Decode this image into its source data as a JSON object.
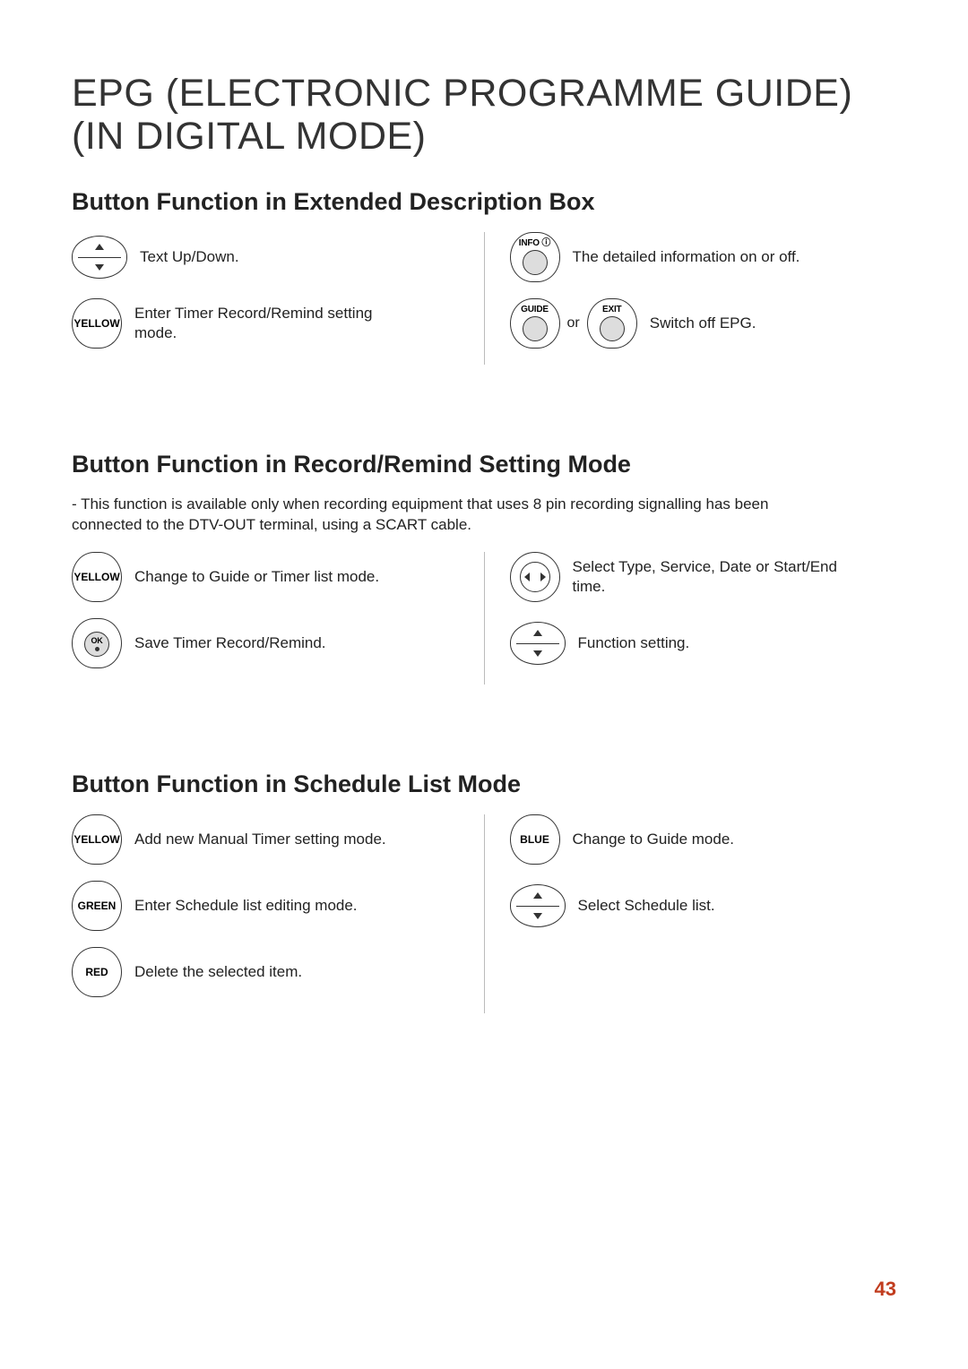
{
  "title_line1": "EPG (ELECTRONIC PROGRAMME GUIDE)",
  "title_line2": "(IN DIGITAL MODE)",
  "page_number": "43",
  "s1": {
    "heading": "Button Function in Extended Description Box",
    "rows_left": [
      {
        "icon": "updown",
        "label": "",
        "desc": "Text Up/Down."
      },
      {
        "icon": "label",
        "label": "YELLOW",
        "desc": "Enter Timer Record/Remind setting mode."
      }
    ],
    "rows_right": [
      {
        "icon": "round",
        "label": "INFO ⓘ",
        "desc": "The detailed information on or off."
      },
      {
        "icon": "guide_or_exit",
        "label1": "GUIDE",
        "or": "or",
        "label2": "EXIT",
        "desc": "Switch off EPG."
      }
    ]
  },
  "s2": {
    "heading": "Button Function in Record/Remind Setting Mode",
    "note": "-  This function is available only when recording equipment that uses 8 pin recording signalling has been connected to the DTV-OUT terminal, using a SCART cable.",
    "rows_left": [
      {
        "icon": "label",
        "label": "YELLOW",
        "desc": "Change to Guide or Timer list mode."
      },
      {
        "icon": "ok",
        "label": "OK",
        "desc": "Save Timer Record/Remind."
      }
    ],
    "rows_right": [
      {
        "icon": "leftright",
        "desc": "Select Type, Service, Date or Start/End time."
      },
      {
        "icon": "updown",
        "desc": "Function setting."
      }
    ]
  },
  "s3": {
    "heading": "Button Function in Schedule List Mode",
    "rows_left": [
      {
        "icon": "label",
        "label": "YELLOW",
        "desc": "Add new Manual Timer setting mode."
      },
      {
        "icon": "label",
        "label": "GREEN",
        "desc": "Enter Schedule list editing mode."
      },
      {
        "icon": "label",
        "label": "RED",
        "desc": "Delete the selected item."
      }
    ],
    "rows_right": [
      {
        "icon": "label",
        "label": "BLUE",
        "desc": "Change to Guide mode."
      },
      {
        "icon": "updown",
        "desc": "Select Schedule list."
      }
    ]
  }
}
